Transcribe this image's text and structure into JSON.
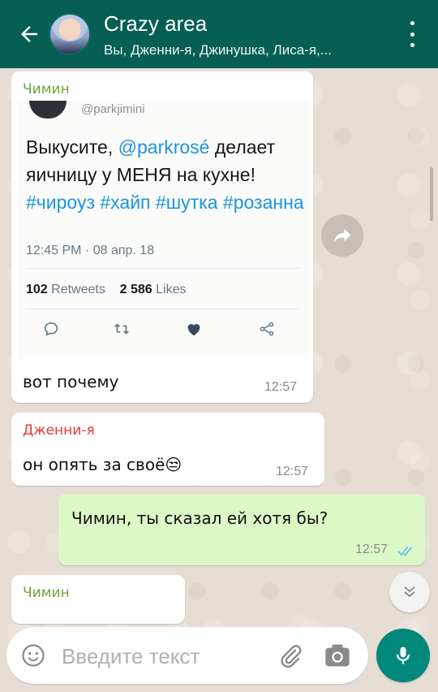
{
  "header": {
    "title": "Crazy area",
    "subtitle": "Вы, Дженни-я, Джинушка, Лиса-я,..."
  },
  "messages": [
    {
      "sender": "Чимин",
      "sender_color": "#6fa33b",
      "tweet": {
        "handle": "@parkjimini",
        "text_part1": "Выкусите, ",
        "mention": "@parkrosé",
        "text_part2": " делает яичницу у МЕНЯ на кухне! ",
        "hashtags": "#чироуз #хайп #шутка #розанна",
        "date": "12:45 PM · 08 апр. 18",
        "retweets_count": "102",
        "retweets_label": "Retweets",
        "likes_count": "2 586",
        "likes_label": "Likes"
      },
      "text": "вот почему",
      "time": "12:57"
    },
    {
      "sender": "Дженни-я",
      "sender_color": "#e53935",
      "text": "он опять за своё😒",
      "time": "12:57"
    },
    {
      "text": "Чимин, ты сказал ей хотя бы?",
      "time": "12:57",
      "status": "read"
    },
    {
      "sender": "Чимин",
      "sender_color": "#6fa33b"
    }
  ],
  "input": {
    "placeholder": "Введите текст"
  },
  "colors": {
    "header_bg": "#075e54",
    "outgoing_bubble": "#dcf8c6",
    "link": "#1b95e0",
    "read_tick": "#4fc3f7",
    "mic_bg": "#00897b"
  },
  "icons": [
    "back-arrow-icon",
    "more-vert-icon",
    "forward-icon",
    "reply-icon",
    "retweet-icon",
    "like-icon",
    "share-icon",
    "double-check-icon",
    "chevron-down-icon",
    "emoji-icon",
    "attach-icon",
    "camera-icon",
    "mic-icon"
  ]
}
